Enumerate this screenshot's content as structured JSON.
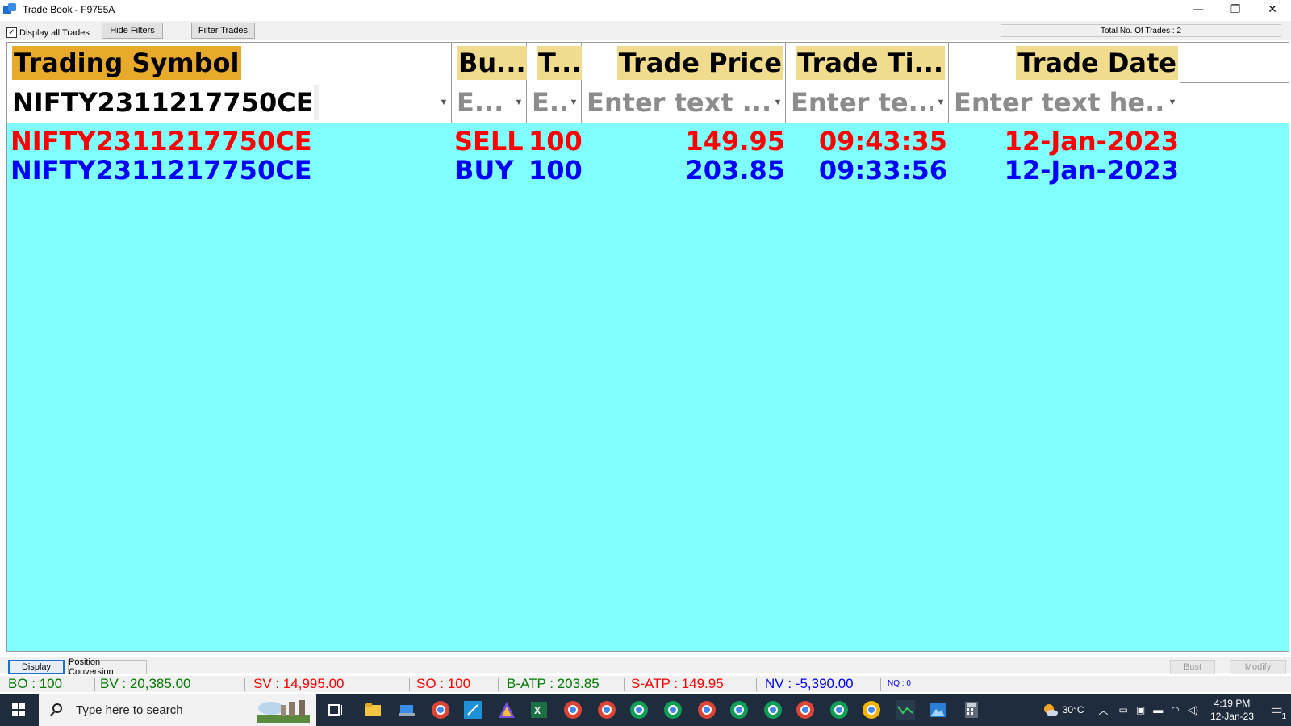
{
  "window": {
    "title": "Trade Book - F9755A",
    "minimize": "—",
    "restore": "❐",
    "close": "✕"
  },
  "toolbar": {
    "display_all_label": "Display all Trades",
    "display_all_checked": true,
    "hide_filters": "Hide Filters",
    "filter_trades": "Filter Trades",
    "total_trades": "Total No. Of Trades : 2"
  },
  "grid": {
    "headers": [
      "Trading Symbol",
      "Bu...",
      "T...",
      "Trade Price",
      "Trade Ti...",
      "Trade Date"
    ],
    "filters": [
      "NIFTY2311217750CE",
      "E...",
      "E..",
      "Enter text ...",
      "Enter te...",
      "Enter text he..."
    ],
    "filter_icon": "▼",
    "rows": [
      {
        "symbol": "NIFTY2311217750CE",
        "side": "SELL",
        "qty": "100",
        "price": "149.95",
        "time": "09:43:35",
        "date": "12-Jan-2023"
      },
      {
        "symbol": "NIFTY2311217750CE",
        "side": "BUY",
        "qty": "100",
        "price": "203.85",
        "time": "09:33:56",
        "date": "12-Jan-2023"
      }
    ],
    "colors": {
      "background": "#80ffff",
      "sell": "#ff0000",
      "buy": "#0000ff",
      "header_bg": "#f0dc8c",
      "sorted_header_bg": "#e8aa2a"
    }
  },
  "tabs": {
    "display": "Display",
    "position_conversion": "Position Conversion",
    "bust": "Bust",
    "modify": "Modify"
  },
  "status": {
    "bo": "BO : 100",
    "bv": "BV : 20,385.00",
    "sv": "SV : 14,995.00",
    "so": "SO : 100",
    "batp": "B-ATP : 203.85",
    "satp": "S-ATP : 149.95",
    "nv": "NV : -5,390.00",
    "nq": "NQ : 0"
  },
  "taskbar": {
    "search_placeholder": "Type here to search",
    "temperature": "30°C",
    "time": "4:19 PM",
    "date": "12-Jan-23",
    "notification_count": "1"
  }
}
